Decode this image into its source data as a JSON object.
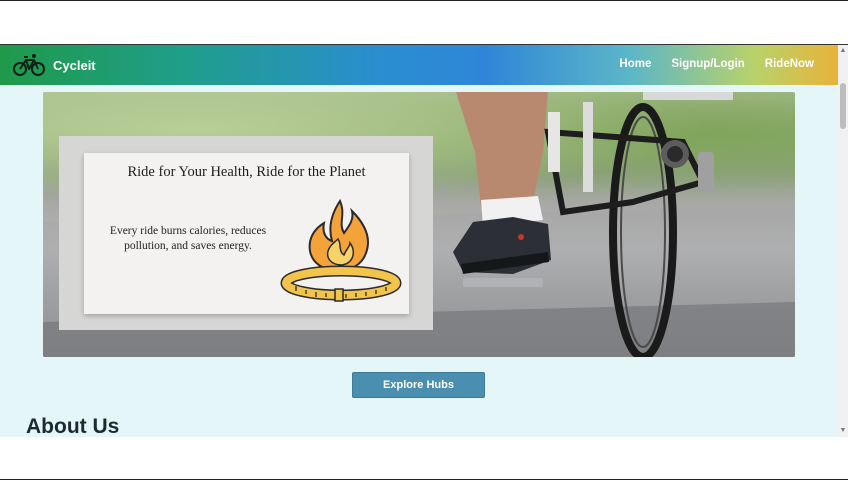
{
  "navbar": {
    "brand_name": "Cycleit",
    "links": [
      {
        "label": "Home"
      },
      {
        "label": "Signup/Login"
      },
      {
        "label": "RideNow"
      }
    ]
  },
  "hero": {
    "card_title": "Ride for Your Health, Ride for the Planet",
    "card_text": "Every ride burns calories, reduces pollution, and saves energy."
  },
  "explore_button": {
    "label": "Explore Hubs"
  },
  "about": {
    "heading": "About Us"
  },
  "icons": {
    "brand": "bicycle-icon",
    "fire": "flame-icon",
    "measure": "measuring-tape-icon"
  },
  "colors": {
    "nav_green": "#1f9a4a",
    "nav_blue": "#2f86d8",
    "nav_gold": "#e9b33a",
    "page_bg": "#e4f6f8",
    "button": "#4a8fb0"
  }
}
